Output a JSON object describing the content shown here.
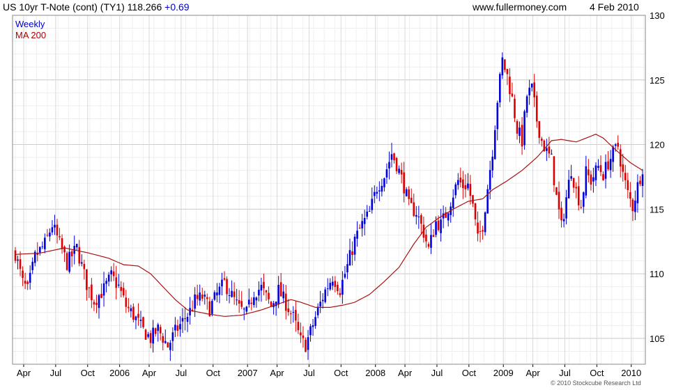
{
  "header": {
    "title": "US 10yr T-Note (cont) (TY1) 118.266",
    "change": "+0.69",
    "site": "www.fullermoney.com",
    "date": "4 Feb 2010"
  },
  "legend": {
    "weekly": "Weekly",
    "ma": "MA 200"
  },
  "copyright": "© 2010 Stockcube Research Ltd",
  "colors": {
    "up": "#0000dd",
    "down": "#dd0000",
    "ma": "#aa1111",
    "grid": "#dddddd"
  },
  "chart_data": {
    "type": "candlestick",
    "y_ticks": [
      105,
      110,
      115,
      120,
      125,
      130
    ],
    "ylim": [
      103,
      130
    ],
    "x_ticks": [
      "Apr",
      "Jul",
      "Oct",
      "2006",
      "Apr",
      "Jul",
      "Oct",
      "2007",
      "Apr",
      "Jul",
      "Oct",
      "2008",
      "Apr",
      "Jul",
      "Oct",
      "2009",
      "Apr",
      "Jul",
      "Oct",
      "2010"
    ],
    "x_tick_weeks": [
      3.4,
      16.4,
      29.4,
      42.4,
      54.4,
      67.4,
      80.4,
      94.4,
      106.4,
      119.4,
      132.4,
      146.4,
      158.4,
      171.4,
      184.4,
      198.4,
      210.4,
      223.4,
      236.4,
      250.4
    ],
    "weeks": 256,
    "close_anchors": [
      [
        0,
        111.6
      ],
      [
        3,
        109.3
      ],
      [
        5,
        108.7
      ],
      [
        8,
        111.3
      ],
      [
        12,
        112.3
      ],
      [
        15,
        113.8
      ],
      [
        17,
        112.8
      ],
      [
        21,
        110.8
      ],
      [
        25,
        112.0
      ],
      [
        29,
        109.2
      ],
      [
        32,
        107.9
      ],
      [
        36,
        108.8
      ],
      [
        39,
        109.8
      ],
      [
        42,
        109.0
      ],
      [
        45,
        107.5
      ],
      [
        48,
        106.8
      ],
      [
        52,
        105.6
      ],
      [
        55,
        105.0
      ],
      [
        58,
        105.7
      ],
      [
        62,
        104.4
      ],
      [
        65,
        105.5
      ],
      [
        68,
        106.3
      ],
      [
        71,
        107.1
      ],
      [
        73,
        107.9
      ],
      [
        76,
        108.2
      ],
      [
        79,
        107.3
      ],
      [
        82,
        108.4
      ],
      [
        85,
        109.3
      ],
      [
        88,
        108.3
      ],
      [
        91,
        107.3
      ],
      [
        94,
        106.9
      ],
      [
        97,
        108.6
      ],
      [
        100,
        108.9
      ],
      [
        104,
        107.5
      ],
      [
        107,
        108.7
      ],
      [
        110,
        107.7
      ],
      [
        113,
        106.6
      ],
      [
        116,
        104.8
      ],
      [
        118,
        104.5
      ],
      [
        120,
        105.5
      ],
      [
        123,
        107.2
      ],
      [
        126,
        108.7
      ],
      [
        129,
        109.8
      ],
      [
        132,
        108.8
      ],
      [
        135,
        110.6
      ],
      [
        138,
        112.6
      ],
      [
        141,
        113.8
      ],
      [
        144,
        114.7
      ],
      [
        147,
        116.7
      ],
      [
        150,
        117.6
      ],
      [
        153,
        119.3
      ],
      [
        155,
        118.5
      ],
      [
        158,
        116.8
      ],
      [
        160,
        115.2
      ],
      [
        163,
        114.8
      ],
      [
        166,
        113.2
      ],
      [
        168,
        111.9
      ],
      [
        171,
        114.0
      ],
      [
        173,
        113.8
      ],
      [
        175,
        114.6
      ],
      [
        178,
        116.2
      ],
      [
        180,
        117.2
      ],
      [
        182,
        116.8
      ],
      [
        184,
        116.9
      ],
      [
        186,
        115.2
      ],
      [
        188,
        112.6
      ],
      [
        190,
        113.8
      ],
      [
        192,
        116.7
      ],
      [
        194,
        119.6
      ],
      [
        196,
        123.5
      ],
      [
        198,
        126.5
      ],
      [
        200,
        125.3
      ],
      [
        202,
        123.5
      ],
      [
        204,
        121.2
      ],
      [
        206,
        120.3
      ],
      [
        208,
        123.8
      ],
      [
        210,
        124.3
      ],
      [
        212,
        121.9
      ],
      [
        214,
        120.3
      ],
      [
        216,
        119.4
      ],
      [
        218,
        118.8
      ],
      [
        220,
        115.9
      ],
      [
        222,
        113.6
      ],
      [
        224,
        115.9
      ],
      [
        226,
        118.1
      ],
      [
        228,
        116.4
      ],
      [
        230,
        115.3
      ],
      [
        232,
        117.8
      ],
      [
        234,
        117.2
      ],
      [
        237,
        118.3
      ],
      [
        239,
        117.7
      ],
      [
        241,
        118.6
      ],
      [
        243,
        119.3
      ],
      [
        245,
        119.9
      ],
      [
        247,
        117.7
      ],
      [
        249,
        116.2
      ],
      [
        251,
        115.2
      ],
      [
        253,
        116.8
      ],
      [
        255,
        118.27
      ]
    ],
    "ma_anchors": [
      [
        0,
        111.5
      ],
      [
        10,
        111.6
      ],
      [
        20,
        112.0
      ],
      [
        30,
        111.6
      ],
      [
        38,
        111.2
      ],
      [
        44,
        110.7
      ],
      [
        50,
        110.6
      ],
      [
        55,
        110.0
      ],
      [
        60,
        109.0
      ],
      [
        65,
        108.0
      ],
      [
        70,
        107.2
      ],
      [
        78,
        106.9
      ],
      [
        85,
        106.7
      ],
      [
        92,
        106.8
      ],
      [
        100,
        107.2
      ],
      [
        106,
        107.6
      ],
      [
        112,
        108.0
      ],
      [
        116,
        107.8
      ],
      [
        122,
        107.4
      ],
      [
        128,
        107.4
      ],
      [
        134,
        107.6
      ],
      [
        138,
        107.8
      ],
      [
        144,
        108.4
      ],
      [
        150,
        109.4
      ],
      [
        156,
        110.5
      ],
      [
        162,
        112.3
      ],
      [
        167,
        113.6
      ],
      [
        172,
        114.3
      ],
      [
        178,
        115.0
      ],
      [
        184,
        115.6
      ],
      [
        190,
        115.8
      ],
      [
        194,
        116.5
      ],
      [
        200,
        117.2
      ],
      [
        206,
        118.0
      ],
      [
        212,
        119.0
      ],
      [
        218,
        120.3
      ],
      [
        222,
        120.4
      ],
      [
        228,
        120.2
      ],
      [
        232,
        120.5
      ],
      [
        236,
        120.8
      ],
      [
        239,
        120.5
      ],
      [
        244,
        119.6
      ],
      [
        250,
        118.6
      ],
      [
        255,
        118.0
      ]
    ]
  }
}
